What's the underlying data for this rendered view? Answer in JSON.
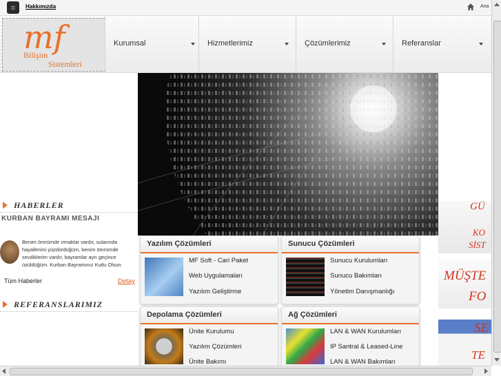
{
  "topbar": {
    "link": "Hakkımızda",
    "right_text": "Ana"
  },
  "logo": {
    "mark": "mf",
    "line1": "Bilişim",
    "line2": "Sistemleri"
  },
  "menu": [
    {
      "label": "Kurumsal"
    },
    {
      "label": "Hizmetlerimiz"
    },
    {
      "label": "Çözümlerimiz"
    },
    {
      "label": "Referanslar"
    }
  ],
  "news": {
    "heading": "HABERLER",
    "title": "KURBAN BAYRAMI MESAJI",
    "text": "Benim ömrümde ırmaklar vardır, sularında hayallerimi yüzdürdüğüm, benim ömrümde sevdiklerim vardır, bayramlar ayrı geçince üzüldüğüm. Kurban Bayramınız Kutlu Olsun",
    "all_link": "Tüm Haberler",
    "detail_link": "Detay"
  },
  "references": {
    "heading": "REFERANSLARIMIZ"
  },
  "panels": {
    "software": {
      "title": "Yazılım Çözümleri",
      "items": [
        "MF Soft - Cari Paket",
        "Web Uygulamaları",
        "Yazılım Geliştirme"
      ]
    },
    "server": {
      "title": "Sunucu Çözümleri",
      "items": [
        "Sunucu Kurulumları",
        "Sunucu Bakımları",
        "Yönetim Danışmanlığı"
      ]
    },
    "storage": {
      "title": "Depolama Çözümleri",
      "items": [
        "Ünite Kurulumu",
        "Yazılım Çözümleri",
        "Ünite Bakımı"
      ]
    },
    "network": {
      "title": "Ağ Çözümleri",
      "items": [
        "LAN & WAN Kurulumları",
        "IP Santral & Leased-Line",
        "LAN & WAN Bakımları"
      ]
    }
  },
  "right_banners": {
    "b1_l1": "GÜ",
    "b1_l2": "KO",
    "b1_l3": "SİST",
    "b2_l1": "MÜŞTE",
    "b2_l2": "FO",
    "b3_l1": "SE",
    "b3_l2": "TE"
  },
  "colors": {
    "accent": "#e8702a",
    "link": "#e05a10"
  }
}
